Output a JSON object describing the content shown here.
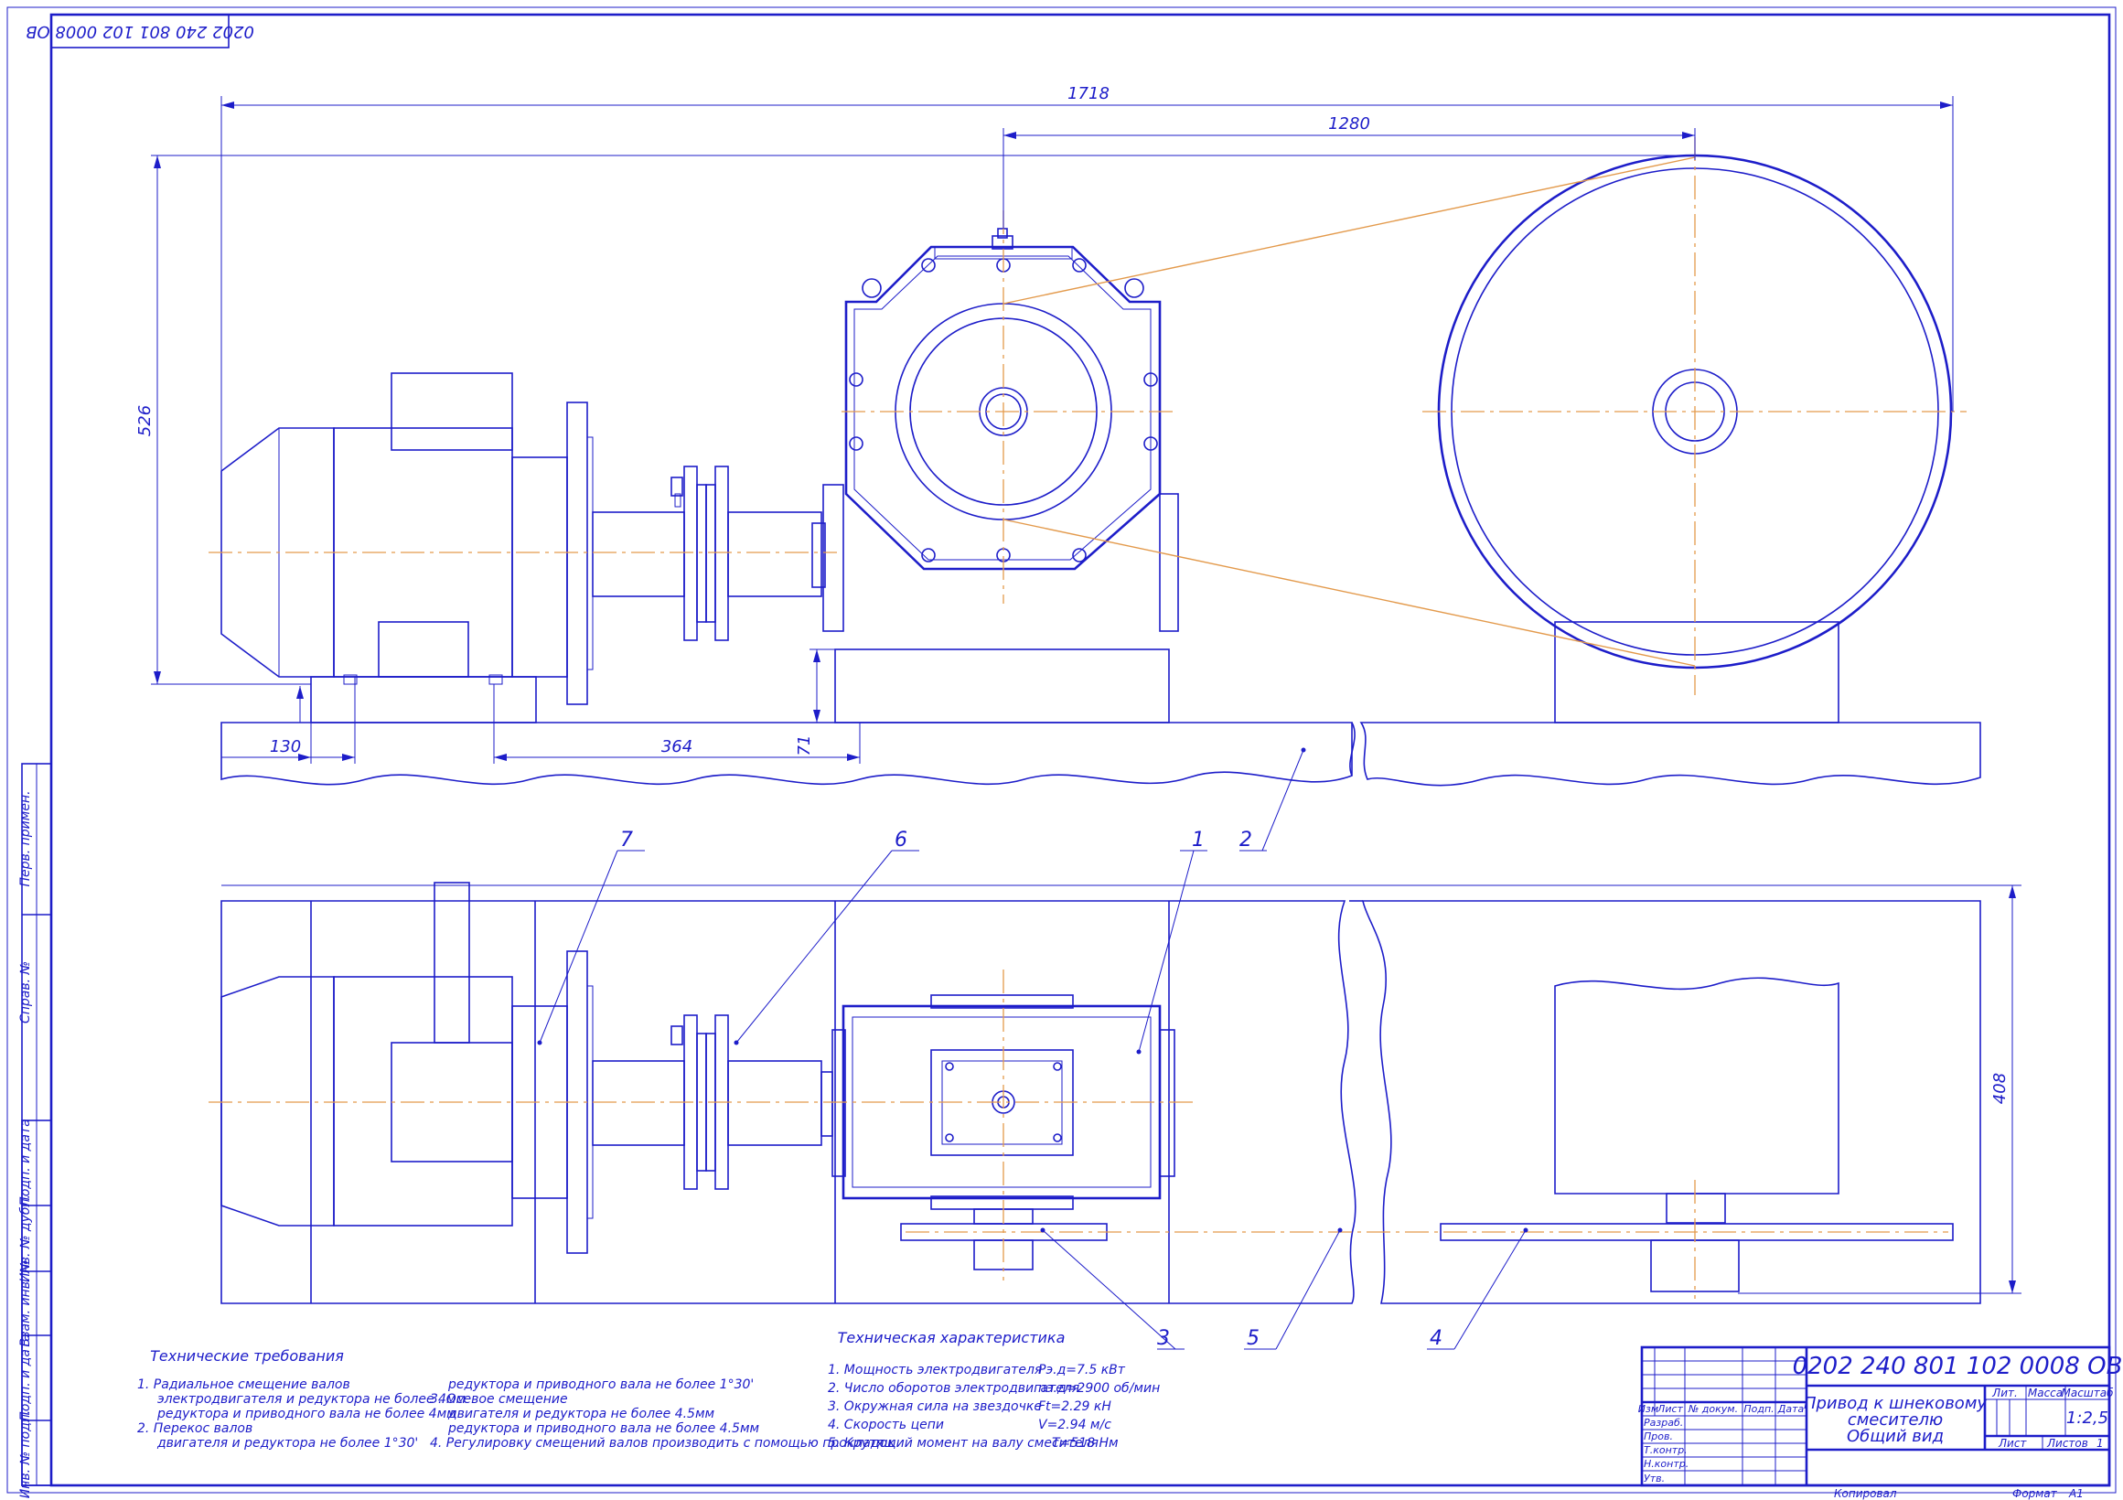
{
  "doc_code": "0202 240 801 102 0008 ОВ",
  "doc_code_rotated": "0202 240 801 102 0008 ОВ",
  "dimensions": {
    "overall_length": "1718",
    "axis_distance": "1280",
    "height": "526",
    "motor_offset": "130",
    "motor_feet": "364",
    "base_height": "71",
    "plan_width": "408"
  },
  "positions": [
    "1",
    "2",
    "3",
    "4",
    "5",
    "6",
    "7"
  ],
  "side_stamps": [
    "Перв. примен.",
    "Справ. №",
    "Подп. и дата",
    "Инв. № дубл.",
    "Взам. инв. №",
    "Подп. и дата",
    "Инв. № подл."
  ],
  "tech_requirements": {
    "title": "Технические требования",
    "col1": [
      "1. Радиальное смещение валов",
      "электродвигателя и редуктора не более 4мм",
      "редуктора и приводного вала не более 4мм",
      "2. Перекос валов",
      "двигателя и редуктора не более 1°30'"
    ],
    "col2": [
      "редуктора и приводного вала не более 1°30'",
      "3. Осевое смещение",
      "двигателя и редуктора не более 4.5мм",
      "редуктора и приводного вала не более 4.5мм",
      "4. Регулировку смещений валов производить с помощью прокладок"
    ]
  },
  "tech_characteristics": {
    "title": "Техническая характеристика",
    "rows": [
      {
        "label": "1. Мощность электродвигателя",
        "value": "Pэ.д=7.5 кВт"
      },
      {
        "label": "2. Число оборотов электродвигателя",
        "value": "nэ.д=2900 об/мин"
      },
      {
        "label": "3. Окружная сила на звездочке",
        "value": "Ft=2.29 кН"
      },
      {
        "label": "4. Скорость цепи",
        "value": "V=2.94 м/с"
      },
      {
        "label": "5. Крутящий момент на валу смесителя",
        "value": "T=518  Нм"
      }
    ]
  },
  "title_block": {
    "code": "0202 240 801 102 0008 ОВ",
    "name_lines": [
      "Привод к шнековому",
      "смесителю",
      "Общий вид"
    ],
    "col_headers": [
      "Изм",
      "Лист",
      "№ докум.",
      "Подп.",
      "Дата"
    ],
    "roles": [
      "Разраб.",
      "Пров.",
      "Т.контр.",
      "",
      "Н.контр.",
      "Утв."
    ],
    "lit": "Лит.",
    "mass": "Масса",
    "scale_label": "Масштаб",
    "scale": "1:2,5",
    "sheet": "Лист",
    "sheets": "Листов",
    "sheets_count": "1",
    "copied": "Копировал",
    "format": "Формат",
    "format_value": "A1"
  }
}
